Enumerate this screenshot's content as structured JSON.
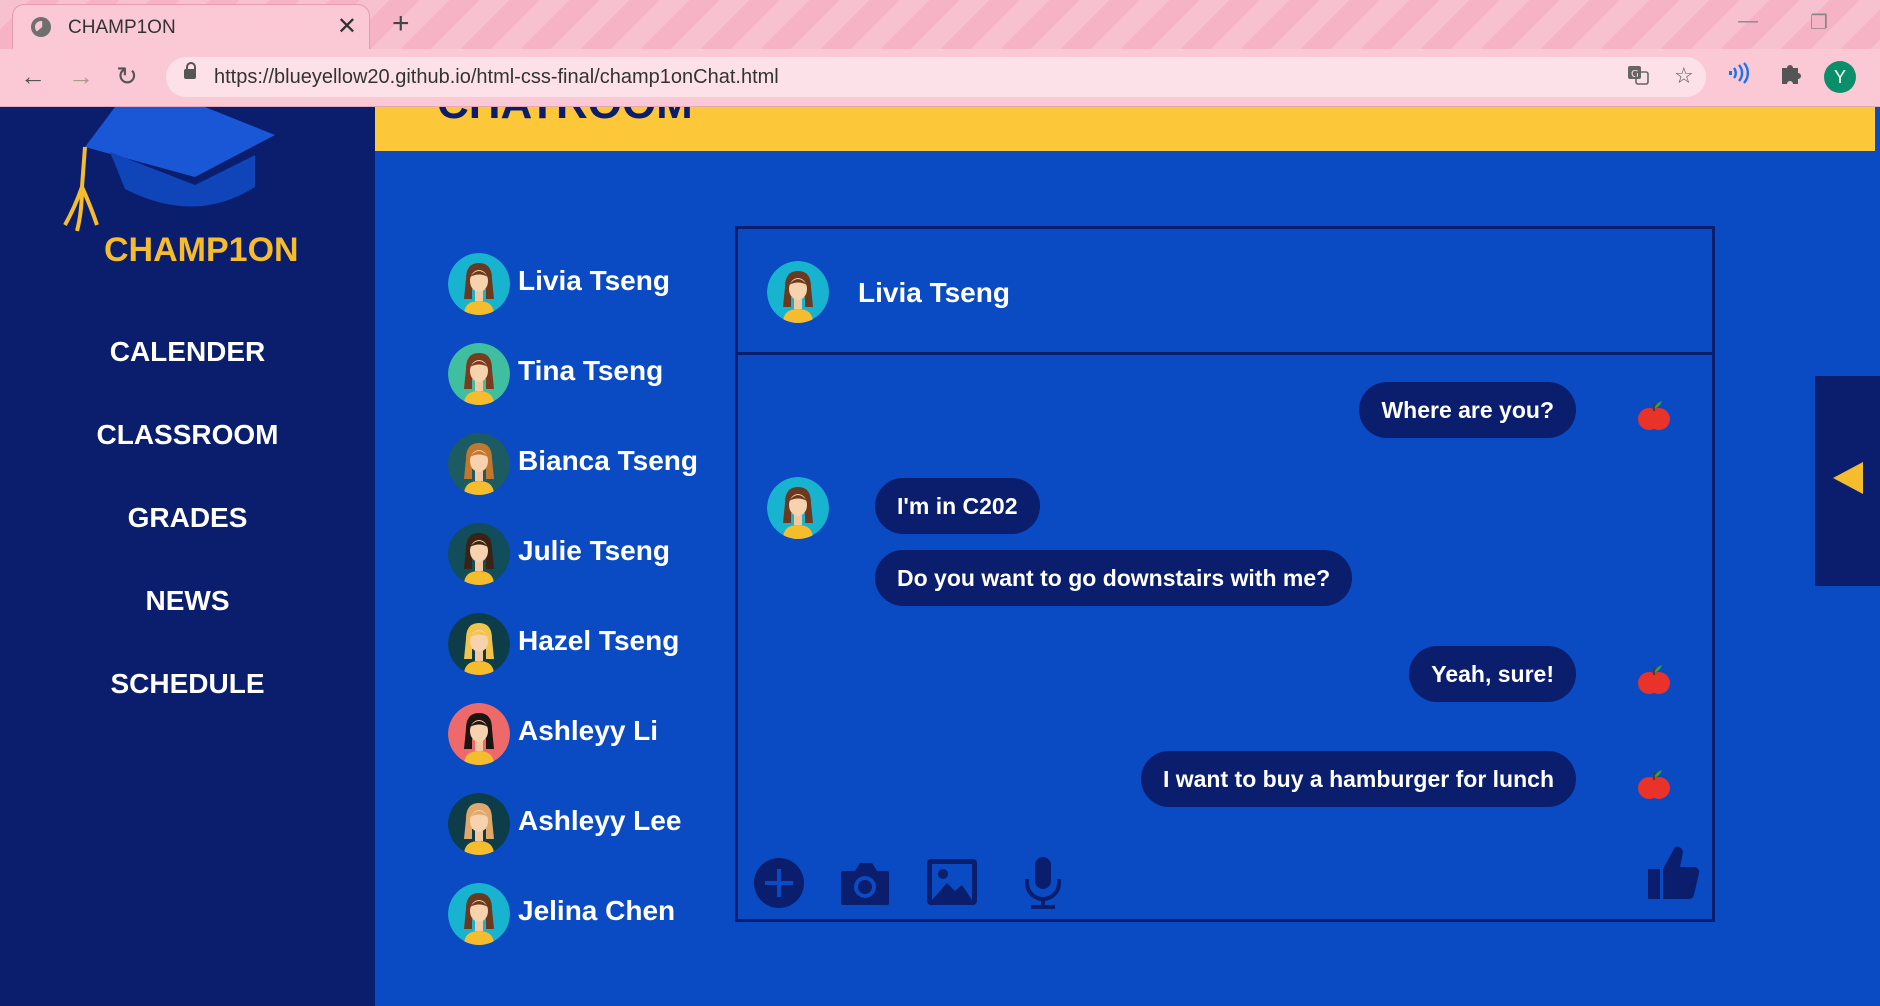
{
  "browser": {
    "tab_title": "CHAMP1ON",
    "tab_close": "✕",
    "new_tab": "+",
    "url": "https://blueyellow20.github.io/html-css-final/champ1onChat.html",
    "profile_initial": "Y",
    "minimize": "—",
    "restore": "❐"
  },
  "brand": {
    "name": "CHAMP1ON"
  },
  "menu": [
    {
      "label": "CALENDER"
    },
    {
      "label": "CLASSROOM"
    },
    {
      "label": "GRADES"
    },
    {
      "label": "NEWS"
    },
    {
      "label": "SCHEDULE"
    }
  ],
  "header": {
    "title": "CHATROOM"
  },
  "contacts": [
    {
      "name": "Livia Tseng",
      "avatar_bg": "#17b3cf",
      "hair": "#6b3a1e"
    },
    {
      "name": "Tina Tseng",
      "avatar_bg": "#3fbfa0",
      "hair": "#7a3b1f"
    },
    {
      "name": "Bianca Tseng",
      "avatar_bg": "#1d5b63",
      "hair": "#c2772f"
    },
    {
      "name": "Julie Tseng",
      "avatar_bg": "#114d5b",
      "hair": "#3b2314"
    },
    {
      "name": "Hazel Tseng",
      "avatar_bg": "#0e3d4a",
      "hair": "#f2c44b"
    },
    {
      "name": "Ashleyy Li",
      "avatar_bg": "#ee6a6a",
      "hair": "#1e1410"
    },
    {
      "name": "Ashleyy Lee",
      "avatar_bg": "#0e3d4a",
      "hair": "#e0a96b"
    },
    {
      "name": "Jelina Chen",
      "avatar_bg": "#17b3cf",
      "hair": "#6b3a1e"
    }
  ],
  "chat": {
    "contact_name": "Livia Tseng",
    "messages": [
      {
        "text": "Where are you?",
        "from": "me"
      },
      {
        "text": "I'm in C202",
        "from": "them"
      },
      {
        "text": "Do you want to go downstairs with me?",
        "from": "them"
      },
      {
        "text": "Yeah, sure!",
        "from": "me"
      },
      {
        "text": "I want to buy a hamburger for lunch",
        "from": "me"
      }
    ]
  },
  "colors": {
    "page_bg": "#0a4ac2",
    "navy": "#0b1d6d",
    "yellow": "#fcc83a",
    "gold": "#f5bd2e"
  },
  "icons": [
    "globe-icon",
    "lock-icon",
    "translate-icon",
    "star-icon",
    "cast-icon",
    "extensions-icon",
    "graduation-cap-icon",
    "apple-icon",
    "plus-circle-icon",
    "camera-icon",
    "image-icon",
    "microphone-icon",
    "thumbs-up-icon",
    "collapse-arrow-icon"
  ]
}
